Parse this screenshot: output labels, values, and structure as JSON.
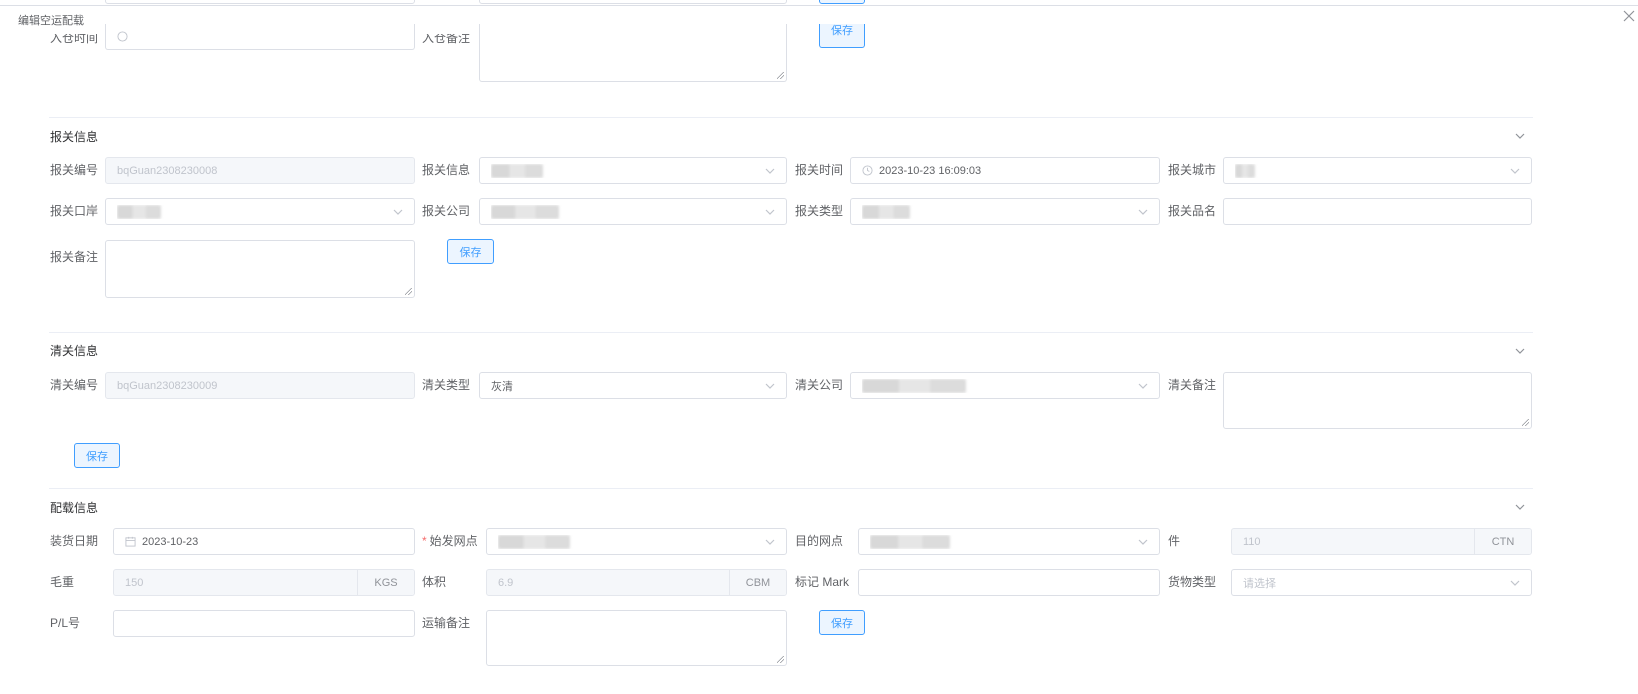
{
  "dialog": {
    "title": "编辑空运配载"
  },
  "top_partial": {
    "warehouse_time_label": "入仓时间",
    "warehouse_note_label": "入仓备注",
    "save_label": "保存"
  },
  "customs_declaration": {
    "title": "报关信息",
    "declaration_no_label": "报关编号",
    "declaration_no_value": "bqGuan2308230008",
    "declaration_info_label": "报关信息",
    "declaration_time_label": "报关时间",
    "declaration_time_value": "2023-10-23 16:09:03",
    "declaration_city_label": "报关城市",
    "declaration_port_label": "报关口岸",
    "declaration_company_label": "报关公司",
    "declaration_type_label": "报关类型",
    "declaration_product_label": "报关品名",
    "declaration_note_label": "报关备注",
    "save_label": "保存"
  },
  "customs_clearance": {
    "title": "清关信息",
    "clearance_no_label": "清关编号",
    "clearance_no_value": "bqGuan2308230009",
    "clearance_type_label": "清关类型",
    "clearance_type_value": "灰清",
    "clearance_company_label": "清关公司",
    "clearance_note_label": "清关备注",
    "save_label": "保存"
  },
  "loading": {
    "title": "配载信息",
    "loading_date_label": "装货日期",
    "loading_date_value": "2023-10-23",
    "origin_label": "始发网点",
    "destination_label": "目的网点",
    "pieces_label": "件",
    "pieces_value": "110",
    "pieces_unit": "CTN",
    "gross_weight_label": "毛重",
    "gross_weight_value": "150",
    "gross_weight_unit": "KGS",
    "volume_label": "体积",
    "volume_value": "6.9",
    "volume_unit": "CBM",
    "mark_label": "标记 Mark",
    "cargo_type_label": "货物类型",
    "cargo_type_placeholder": "请选择",
    "pl_no_label": "P/L号",
    "transport_note_label": "运输备注",
    "save_label": "保存"
  },
  "colors": {
    "primary": "#409eff",
    "border": "#dcdfe6",
    "disabled_bg": "#f5f7fa",
    "required": "#f56c6c"
  },
  "icons": [
    "close-icon",
    "clock-icon",
    "calendar-icon",
    "chevron-down-icon"
  ]
}
